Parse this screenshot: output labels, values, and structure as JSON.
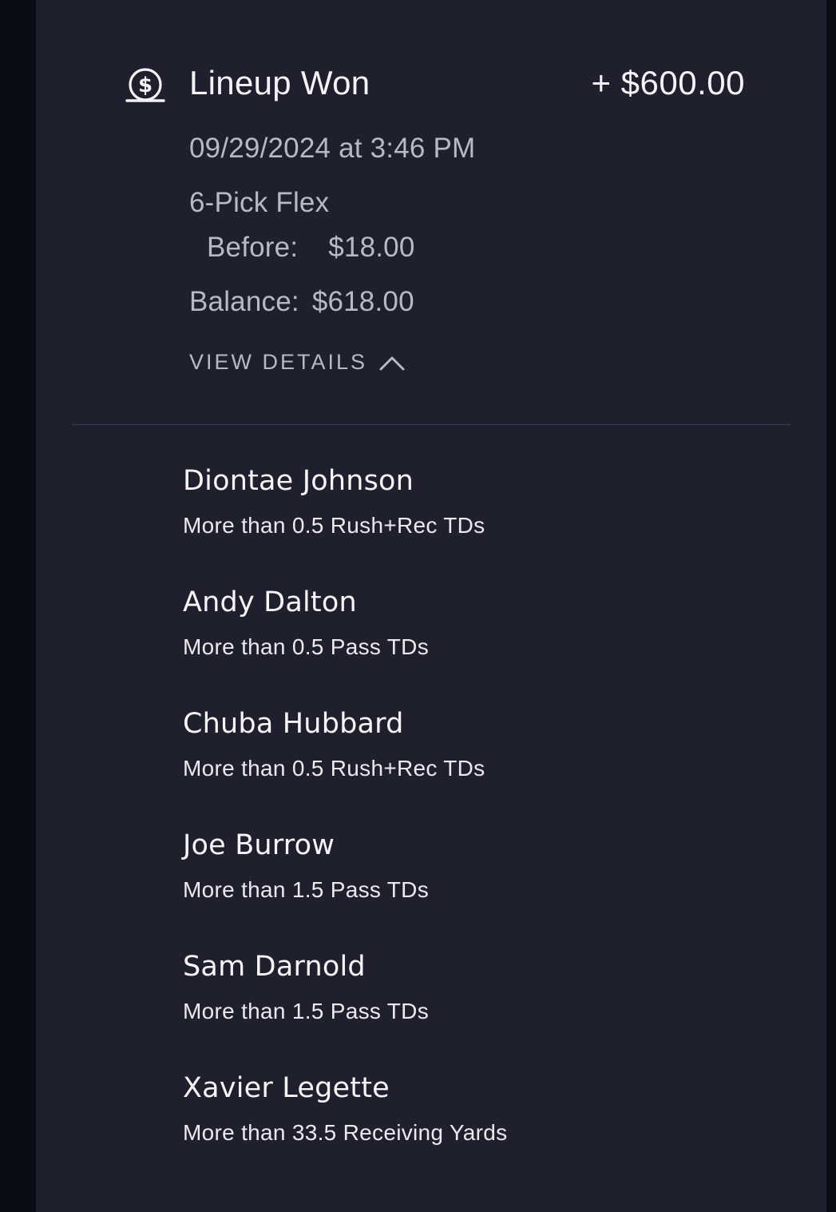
{
  "header": {
    "icon": "dollar-coin-icon",
    "title": "Lineup Won",
    "amount": "+ $600.00"
  },
  "details": {
    "date": "09/29/2024 at 3:46 PM",
    "type": "6-Pick Flex",
    "before_label": "Before:",
    "before_value": "$18.00",
    "balance_label": "Balance:",
    "balance_value": "$618.00",
    "toggle_label": "VIEW DETAILS",
    "toggle_icon": "chevron-up-icon"
  },
  "picks": [
    {
      "player": "Diontae Johnson",
      "line": "More than 0.5 Rush+Rec TDs"
    },
    {
      "player": "Andy Dalton",
      "line": "More than 0.5 Pass TDs"
    },
    {
      "player": "Chuba Hubbard",
      "line": "More than 0.5 Rush+Rec TDs"
    },
    {
      "player": "Joe Burrow",
      "line": "More than 1.5 Pass TDs"
    },
    {
      "player": "Sam Darnold",
      "line": "More than 1.5 Pass TDs"
    },
    {
      "player": "Xavier Legette",
      "line": "More than 33.5 Receiving Yards"
    }
  ],
  "colors": {
    "background": "#0b0d16",
    "card": "#1e202d",
    "text_primary": "#f2f3f6",
    "text_secondary": "#b7bac4"
  }
}
